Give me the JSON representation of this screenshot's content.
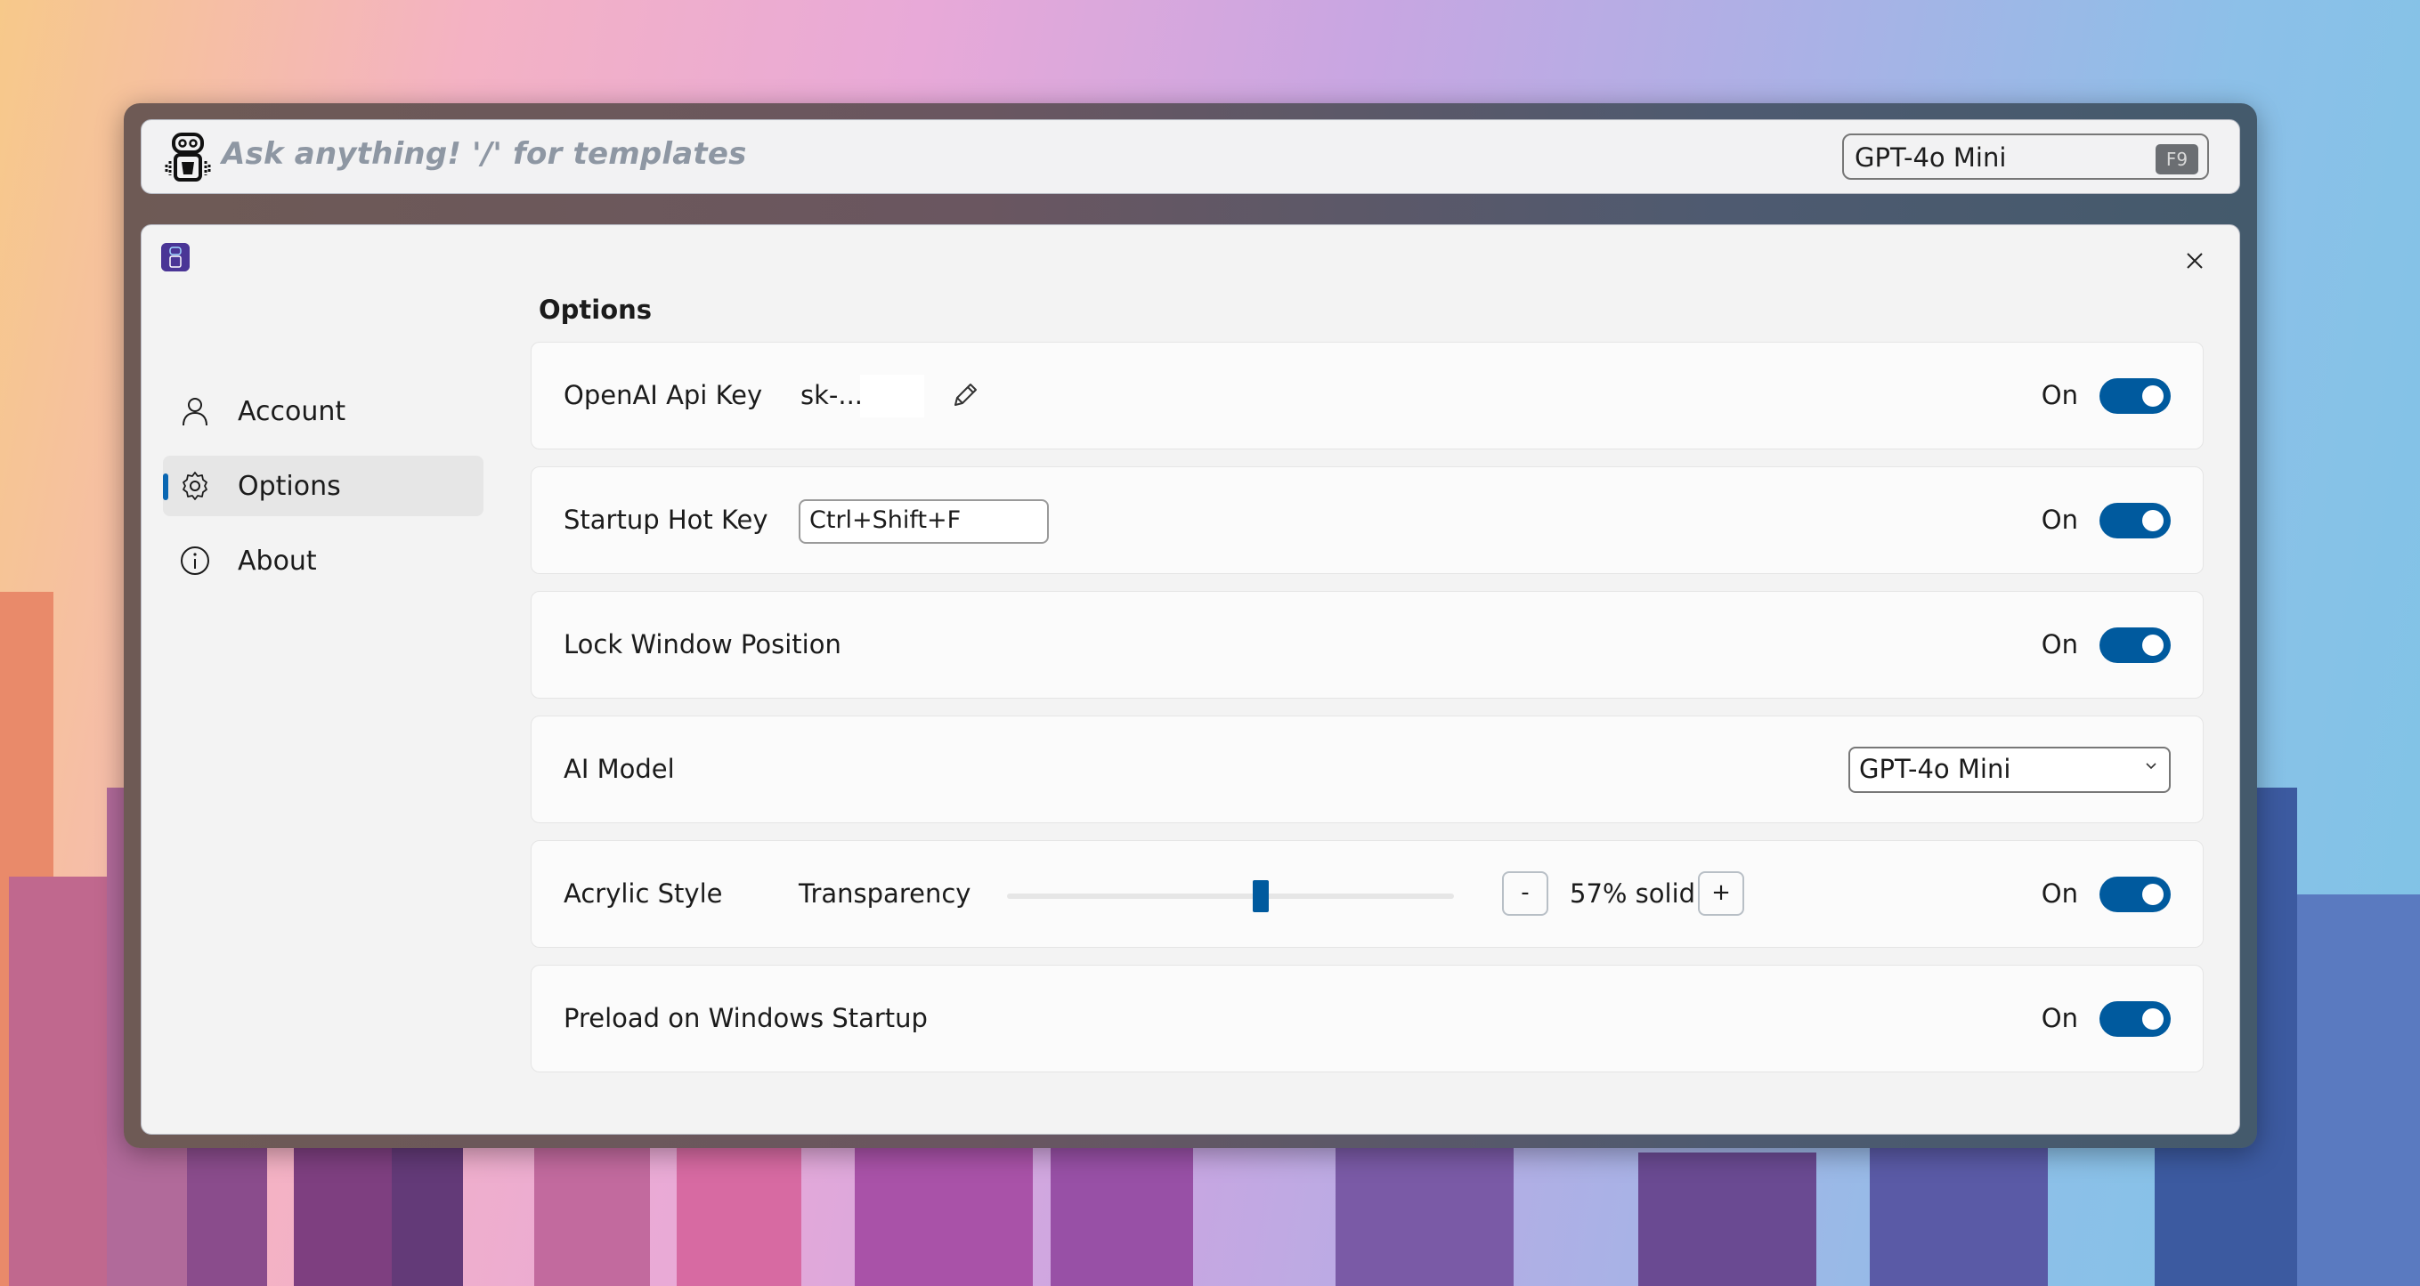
{
  "search": {
    "placeholder": "Ask anything!   '/' for templates",
    "model_label": "GPT-4o Mini",
    "shortcut": "F9"
  },
  "sidebar": {
    "items": [
      {
        "label": "Account",
        "icon": "person-icon",
        "active": false
      },
      {
        "label": "Options",
        "icon": "gear-icon",
        "active": true
      },
      {
        "label": "About",
        "icon": "info-icon",
        "active": false
      }
    ]
  },
  "main": {
    "section_title": "Options",
    "rows": {
      "api_key": {
        "title": "OpenAI Api Key",
        "value": "sk-...",
        "toggle": "On"
      },
      "hot_key": {
        "title": "Startup Hot Key",
        "value": "Ctrl+Shift+F",
        "toggle": "On"
      },
      "lock_window": {
        "title": "Lock Window Position",
        "toggle": "On"
      },
      "ai_model": {
        "title": "AI Model",
        "selected": "GPT-4o Mini"
      },
      "acrylic": {
        "title": "Acrylic Style",
        "sub_label": "Transparency",
        "slider_value_percent": 57,
        "value_text": "57% solid",
        "minus_label": "-",
        "plus_label": "+",
        "toggle": "On"
      },
      "preload": {
        "title": "Preload on Windows Startup",
        "toggle": "On"
      }
    }
  },
  "colors": {
    "accent": "#005a9e",
    "nav_indicator": "#0a67b2",
    "window_bg": "#f3f3f3",
    "card_bg": "#fbfbfb"
  }
}
